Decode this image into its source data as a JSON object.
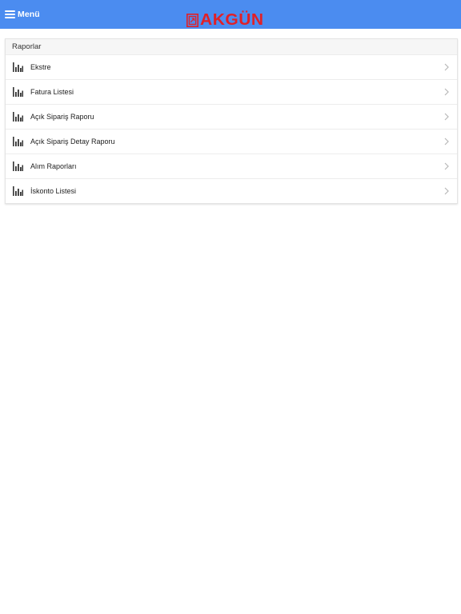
{
  "header": {
    "menu_label": "Menü",
    "logo_text": "AKGÜN",
    "background_color": "#4b8cf0",
    "logo_color": "#e12027"
  },
  "reports": {
    "title": "Raporlar",
    "items": [
      {
        "label": "Ekstre",
        "icon": "bar-chart-icon"
      },
      {
        "label": "Fatura Listesi",
        "icon": "bar-chart-icon"
      },
      {
        "label": "Açık Sipariş Raporu",
        "icon": "bar-chart-icon"
      },
      {
        "label": "Açık Sipariş Detay Raporu",
        "icon": "bar-chart-icon"
      },
      {
        "label": "Alım Raporları",
        "icon": "bar-chart-icon"
      },
      {
        "label": "İskonto Listesi",
        "icon": "bar-chart-icon"
      }
    ]
  }
}
